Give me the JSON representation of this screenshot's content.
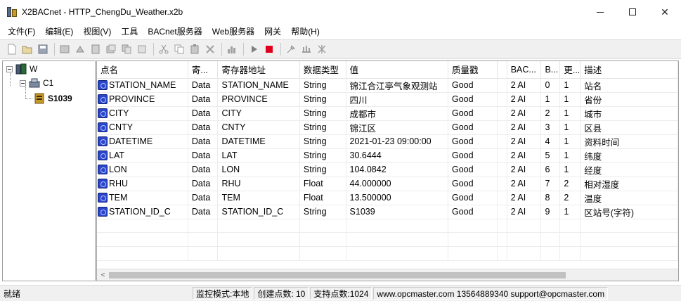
{
  "window": {
    "title": "X2BACnet - HTTP_ChengDu_Weather.x2b",
    "min_icon": "minimize-icon",
    "max_icon": "maximize-icon",
    "close_glyph": "✕"
  },
  "menu": [
    "文件(F)",
    "编辑(E)",
    "视图(V)",
    "工具",
    "BACnet服务器",
    "Web服务器",
    "网关",
    "帮助(H)"
  ],
  "tree": {
    "root": "W",
    "channel": "C1",
    "device": "S1039"
  },
  "grid": {
    "columns": [
      "点名",
      "寄...",
      "寄存器地址",
      "数据类型",
      "值",
      "质量戳",
      "",
      "BAC...",
      "B...",
      "更...",
      "描述"
    ],
    "rows": [
      [
        "STATION_NAME",
        "Data",
        "STATION_NAME",
        "String",
        "锦江合江亭气象观测站",
        "Good",
        "",
        "2 AI",
        "0",
        "1",
        "站名"
      ],
      [
        "PROVINCE",
        "Data",
        "PROVINCE",
        "String",
        "四川",
        "Good",
        "",
        "2 AI",
        "1",
        "1",
        "省份"
      ],
      [
        "CITY",
        "Data",
        "CITY",
        "String",
        "成都市",
        "Good",
        "",
        "2 AI",
        "2",
        "1",
        "城市"
      ],
      [
        "CNTY",
        "Data",
        "CNTY",
        "String",
        "锦江区",
        "Good",
        "",
        "2 AI",
        "3",
        "1",
        "区县"
      ],
      [
        "DATETIME",
        "Data",
        "DATETIME",
        "String",
        "2021-01-23 09:00:00",
        "Good",
        "",
        "2 AI",
        "4",
        "1",
        "资料时间"
      ],
      [
        "LAT",
        "Data",
        "LAT",
        "String",
        "30.6444",
        "Good",
        "",
        "2 AI",
        "5",
        "1",
        "纬度"
      ],
      [
        "LON",
        "Data",
        "LON",
        "String",
        "104.0842",
        "Good",
        "",
        "2 AI",
        "6",
        "1",
        "经度"
      ],
      [
        "RHU",
        "Data",
        "RHU",
        "Float",
        "44.000000",
        "Good",
        "",
        "2 AI",
        "7",
        "2",
        "相对湿度"
      ],
      [
        "TEM",
        "Data",
        "TEM",
        "Float",
        "13.500000",
        "Good",
        "",
        "2 AI",
        "8",
        "2",
        "温度"
      ],
      [
        "STATION_ID_C",
        "Data",
        "STATION_ID_C",
        "String",
        "S1039",
        "Good",
        "",
        "2 AI",
        "9",
        "1",
        "区站号(字符)"
      ]
    ],
    "scroll_left_glyph": "<"
  },
  "status": {
    "ready": "就绪",
    "mode": "监控模式:本地",
    "created": "创建点数:  10",
    "supported": "支持点数:1024",
    "contact": "www.opcmaster.com 13564889340 support@opcmaster.com"
  },
  "colors": {
    "accent_blue": "#2945c9",
    "stop_red": "#e0001b",
    "play_gray": "#808080"
  }
}
